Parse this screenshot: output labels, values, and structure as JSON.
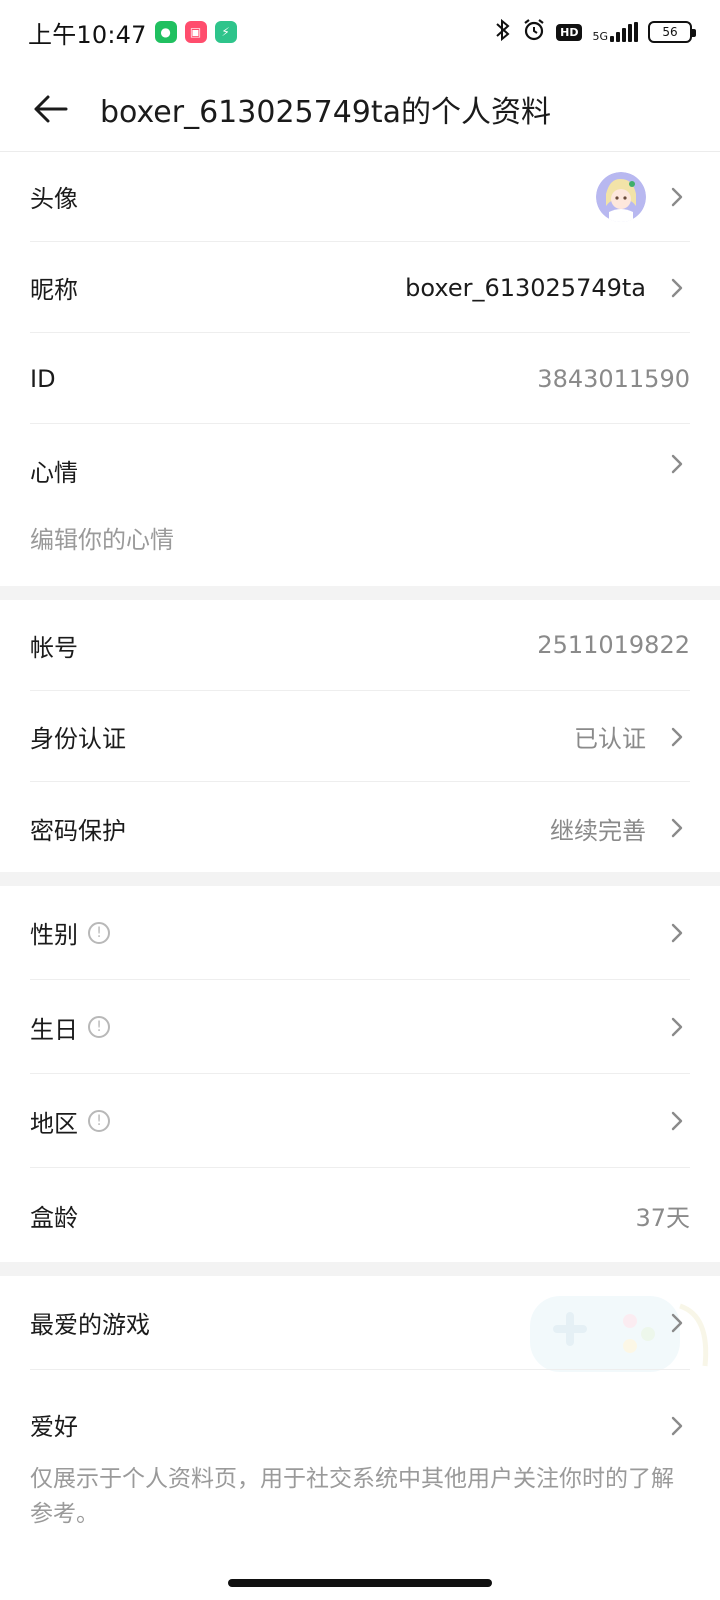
{
  "status_bar": {
    "time": "上午10:47",
    "network": "5G",
    "battery": "56"
  },
  "header": {
    "title": "boxer_613025749ta的个人资料"
  },
  "profile": {
    "avatar_label": "头像",
    "nickname_label": "昵称",
    "nickname_value": "boxer_613025749ta",
    "id_label": "ID",
    "id_value": "3843011590",
    "mood_label": "心情",
    "mood_placeholder": "编辑你的心情"
  },
  "account": {
    "account_label": "帐号",
    "account_value": "2511019822",
    "identity_label": "身份认证",
    "identity_value": "已认证",
    "password_label": "密码保护",
    "password_value": "继续完善"
  },
  "personal": {
    "gender_label": "性别",
    "birthday_label": "生日",
    "region_label": "地区",
    "age_label": "盒龄",
    "age_value": "37天"
  },
  "interests": {
    "fav_games_label": "最爱的游戏",
    "hobbies_label": "爱好",
    "hobbies_note": "仅展示于个人资料页，用于社交系统中其他用户关注你时的了解参考。"
  },
  "colors": {
    "text_primary": "#1b1b1b",
    "text_secondary": "#8a8a8a",
    "divider": "#eeeeee",
    "section_gap": "#f3f3f3"
  }
}
